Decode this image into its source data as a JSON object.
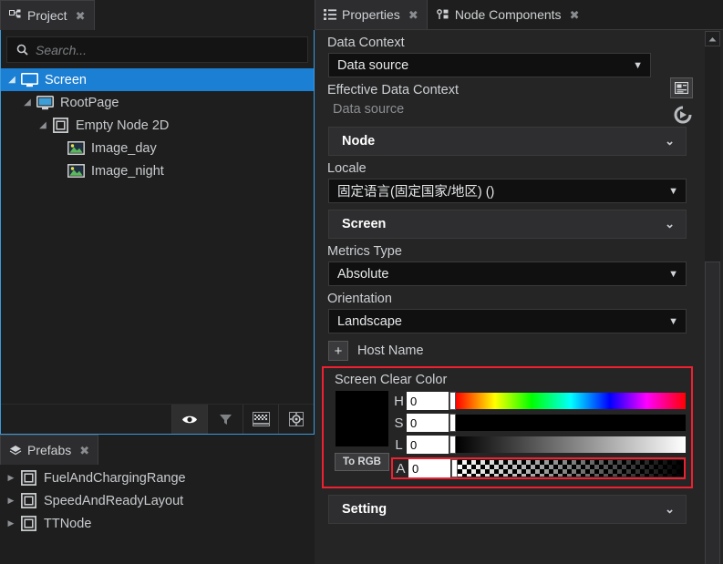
{
  "left": {
    "project_tab": {
      "label": "Project",
      "icon": "hierarchy-icon",
      "close": "✖"
    },
    "search": {
      "placeholder": "Search...",
      "value": "",
      "icon": "search-icon"
    },
    "tree": [
      {
        "label": "Screen",
        "icon": "monitor-icon",
        "depth": 0,
        "twisty": "◢",
        "selected": true
      },
      {
        "label": "RootPage",
        "icon": "page-monitor-icon",
        "depth": 1,
        "twisty": "◢",
        "selected": false
      },
      {
        "label": "Empty Node 2D",
        "icon": "square-node-icon",
        "depth": 2,
        "twisty": "◢",
        "selected": false
      },
      {
        "label": "Image_day",
        "icon": "image-icon",
        "depth": 3,
        "twisty": "",
        "selected": false
      },
      {
        "label": "Image_night",
        "icon": "image-icon",
        "depth": 3,
        "twisty": "",
        "selected": false
      }
    ],
    "toolbar": [
      {
        "name": "visibility-eye-icon",
        "active": true
      },
      {
        "name": "filter-funnel-icon",
        "active": false
      },
      {
        "name": "checkerboard-icon",
        "active": false
      },
      {
        "name": "focus-target-icon",
        "active": false
      }
    ],
    "prefabs_tab": {
      "label": "Prefabs",
      "icon": "layers-icon",
      "close": "✖"
    },
    "prefabs": [
      {
        "label": "FuelAndChargingRange",
        "icon": "square-node-icon",
        "twisty": "▶"
      },
      {
        "label": "SpeedAndReadyLayout",
        "icon": "square-node-icon",
        "twisty": "▶"
      },
      {
        "label": "TTNode",
        "icon": "square-node-icon",
        "twisty": "▶"
      }
    ]
  },
  "right": {
    "tabs": [
      {
        "label": "Properties",
        "icon": "list-icon",
        "close": "✖",
        "active": true
      },
      {
        "label": "Node Components",
        "icon": "nodes-icon",
        "close": "✖",
        "active": false
      }
    ],
    "data_context": {
      "label": "Data Context",
      "value": "Data source",
      "caret": "▼",
      "picker_icon": "data-source-icon",
      "reset_icon": "reset-arrow-icon"
    },
    "effective_data_context": {
      "label": "Effective Data Context",
      "value": "Data source"
    },
    "node_section": {
      "label": "Node",
      "chevron": "⌄"
    },
    "locale": {
      "label": "Locale",
      "value": "固定语言(固定国家/地区) ()",
      "caret": "▼"
    },
    "screen_section": {
      "label": "Screen",
      "chevron": "⌄"
    },
    "metrics_type": {
      "label": "Metrics Type",
      "value": "Absolute",
      "caret": "▼"
    },
    "orientation": {
      "label": "Orientation",
      "value": "Landscape",
      "caret": "▼"
    },
    "host_name": {
      "label": "Host Name",
      "add": "+"
    },
    "clear_color": {
      "title": "Screen Clear Color",
      "swatch_hex": "#000000",
      "to_rgb_label": "To RGB",
      "channels": [
        {
          "name": "H",
          "value": "0",
          "track": "hue"
        },
        {
          "name": "S",
          "value": "0",
          "track": "saturation"
        },
        {
          "name": "L",
          "value": "0",
          "track": "lightness"
        },
        {
          "name": "A",
          "value": "0",
          "track": "alpha"
        }
      ]
    },
    "setting_section": {
      "label": "Setting",
      "chevron": "⌄"
    },
    "highlight_color": "#ef2030"
  }
}
